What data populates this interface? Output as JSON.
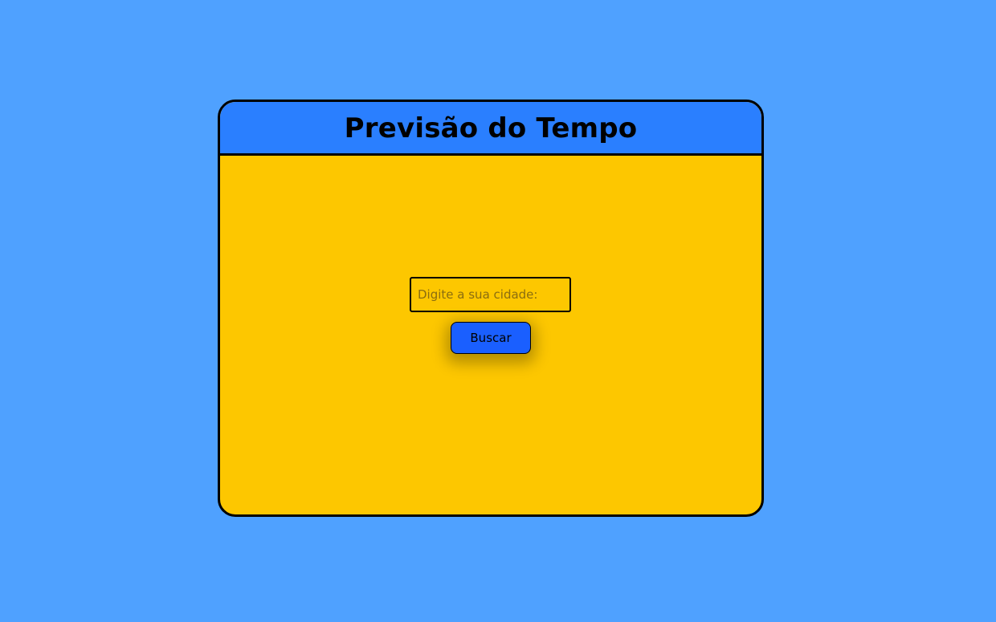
{
  "page": {
    "background_color": "#4fa1ff"
  },
  "card": {
    "header": {
      "title": "Previsão do Tempo",
      "color": "#2a7fff"
    },
    "body_color": "#fdc700",
    "search": {
      "input_value": "",
      "placeholder": "Digite a sua cidade:",
      "button_label": "Buscar",
      "button_color": "#1a5fff"
    }
  }
}
